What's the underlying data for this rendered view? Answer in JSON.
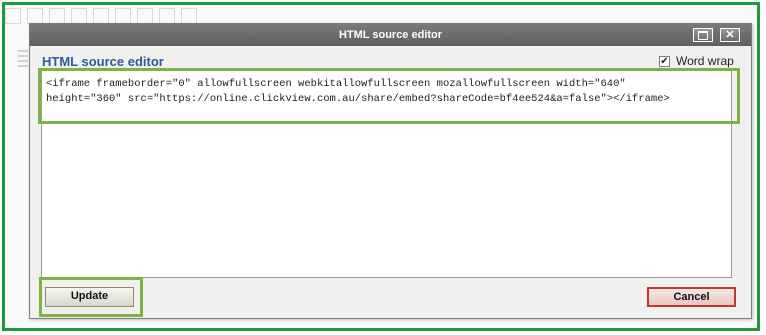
{
  "dialog": {
    "title": "HTML source editor",
    "heading": "HTML source editor",
    "word_wrap_label": "Word wrap",
    "word_wrap_checked": true,
    "code_lines": [
      "<iframe frameborder=\"0\" allowfullscreen webkitallowfullscreen mozallowfullscreen width=\"640\"",
      "height=\"360\" src=\"https://online.clickview.com.au/share/embed?shareCode=bf4ee524&a=false\"></iframe>"
    ],
    "update_label": "Update",
    "cancel_label": "Cancel",
    "check_glyph": "✔",
    "close_glyph": "✕"
  },
  "colors": {
    "highlight_green": "#7cb342",
    "outer_green": "#1f9a3a",
    "heading_blue": "#2b5a9d",
    "cancel_red": "#c0392b"
  },
  "icons": [
    "maximize-icon",
    "close-icon",
    "checkmark-icon"
  ]
}
